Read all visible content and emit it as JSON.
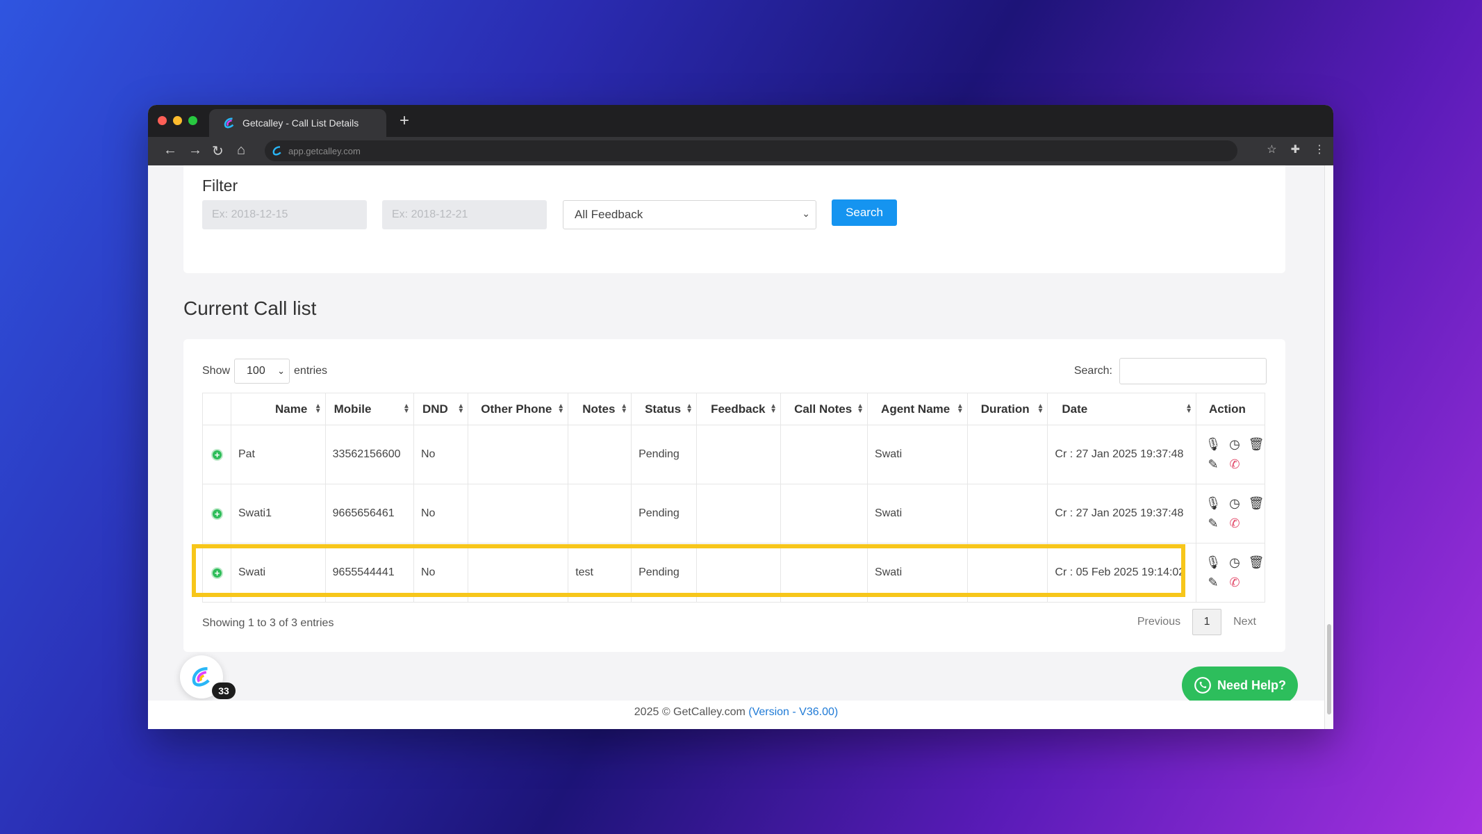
{
  "browser": {
    "tab_title": "Getcalley - Call List Details",
    "url": "app.getcalley.com"
  },
  "filter": {
    "title": "Filter",
    "from_placeholder": "Ex: 2018-12-15",
    "to_placeholder": "Ex: 2018-12-21",
    "feedback_selected": "All Feedback",
    "search_label": "Search"
  },
  "section_title": "Current Call list",
  "list": {
    "show_label": "Show",
    "entries_value": "100",
    "entries_label": "entries",
    "search_label": "Search:",
    "columns": [
      "Name",
      "Mobile",
      "DND",
      "Other Phone",
      "Notes",
      "Status",
      "Feedback",
      "Call Notes",
      "Agent Name",
      "Duration",
      "Date",
      "Action"
    ],
    "rows": [
      {
        "name": "Pat",
        "mobile": "33562156600",
        "dnd": "No",
        "other_phone": "",
        "notes": "",
        "status": "Pending",
        "feedback": "",
        "call_notes": "",
        "agent": "Swati",
        "duration": "",
        "date": "Cr : 27 Jan 2025 19:37:48"
      },
      {
        "name": "Swati1",
        "mobile": "9665656461",
        "dnd": "No",
        "other_phone": "",
        "notes": "",
        "status": "Pending",
        "feedback": "",
        "call_notes": "",
        "agent": "Swati",
        "duration": "",
        "date": "Cr : 27 Jan 2025 19:37:48"
      },
      {
        "name": "Swati",
        "mobile": "9655544441",
        "dnd": "No",
        "other_phone": "",
        "notes": "test",
        "status": "Pending",
        "feedback": "",
        "call_notes": "",
        "agent": "Swati",
        "duration": "",
        "date": "Cr : 05 Feb 2025 19:14:02"
      }
    ],
    "showing_text": "Showing 1 to 3 of 3 entries",
    "pager": {
      "previous": "Previous",
      "current": "1",
      "next": "Next"
    }
  },
  "badge_count": "33",
  "need_help": "Need Help?",
  "footer": {
    "copyright": "2025 © GetCalley.com",
    "version": "(Version - V36.00)"
  },
  "colors": {
    "accent": "#1594f0",
    "highlight": "#f7c61a",
    "whatsapp": "#2dbe5c"
  }
}
